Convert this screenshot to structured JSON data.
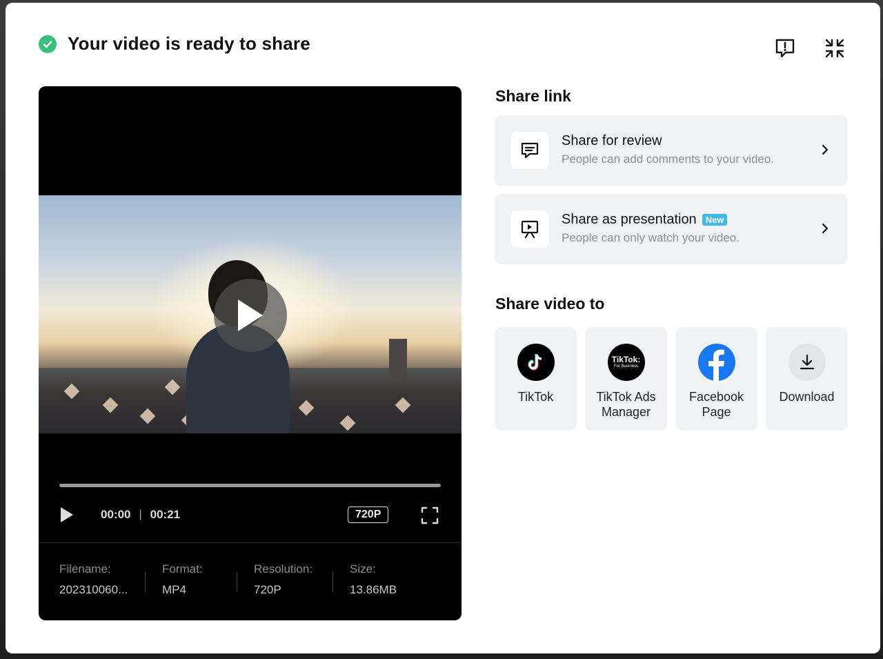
{
  "header": {
    "title": "Your video is ready to share",
    "status_color": "#3cbf7a"
  },
  "player": {
    "current_time": "00:00",
    "separator": "|",
    "duration": "00:21",
    "quality": "720P",
    "progress_fraction": 0.0
  },
  "file_info": [
    {
      "key": "Filename:",
      "value": "202310060..."
    },
    {
      "key": "Format:",
      "value": "MP4"
    },
    {
      "key": "Resolution:",
      "value": "720P"
    },
    {
      "key": "Size:",
      "value": "13.86MB"
    }
  ],
  "share_link": {
    "title": "Share link",
    "items": [
      {
        "title": "Share for review",
        "description": "People can add comments to your video.",
        "icon": "comment-icon"
      },
      {
        "title": "Share as presentation",
        "badge": "New",
        "description": "People can only watch your video.",
        "icon": "presentation-icon"
      }
    ]
  },
  "share_video": {
    "title": "Share video to",
    "destinations": [
      {
        "label": "TikTok",
        "icon": "tiktok-icon"
      },
      {
        "label": "TikTok Ads Manager",
        "icon": "tiktok-business-icon",
        "logo_text": "TikTok:",
        "logo_subtext": "For Business"
      },
      {
        "label": "Facebook Page",
        "icon": "facebook-icon"
      },
      {
        "label": "Download",
        "icon": "download-icon"
      }
    ]
  },
  "colors": {
    "accent_badge": "#42b8e6",
    "facebook": "#1877f2",
    "card_bg": "#f0f2f4"
  }
}
